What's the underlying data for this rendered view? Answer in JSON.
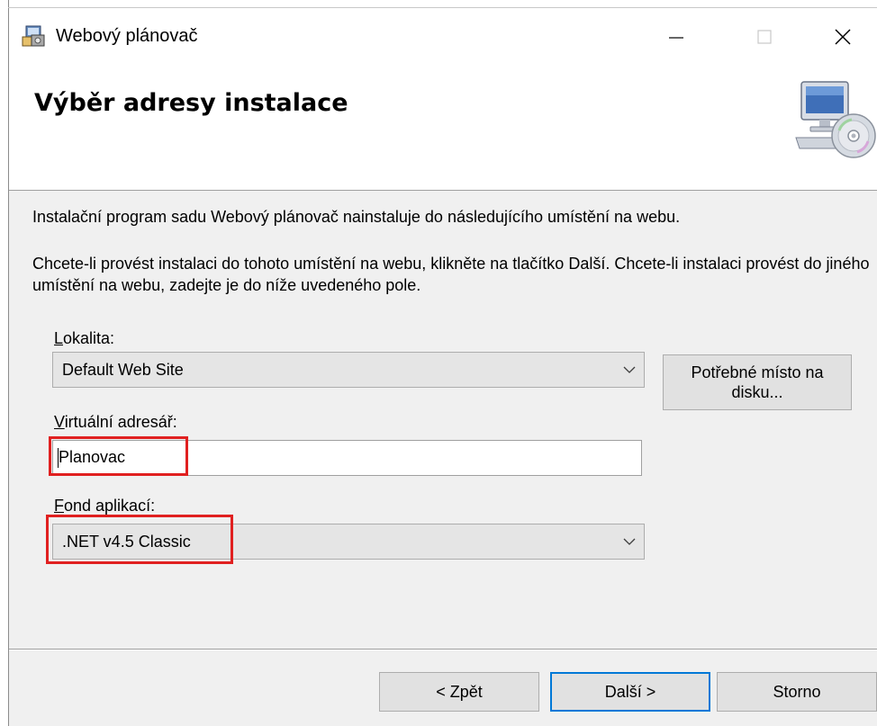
{
  "window": {
    "title": "Webový plánovač",
    "controls": {
      "minimize": "—",
      "close": "✕"
    }
  },
  "banner": {
    "title": "Výběr adresy instalace",
    "icon": "computer-cd-icon"
  },
  "body": {
    "intro": "Instalační program sadu Webový plánovač nainstaluje do následujícího umístění na webu.",
    "instructions": "Chcete-li provést instalaci do tohoto umístění na webu, klikněte na tlačítko Další. Chcete-li instalaci provést do jiného umístění na webu, zadejte je do níže uvedeného pole."
  },
  "fields": {
    "site": {
      "label_first": "L",
      "label_rest": "okalita:",
      "value": "Default Web Site"
    },
    "disk_button": {
      "line1": "Potřebné místo na",
      "line2": "disku..."
    },
    "virtual_dir": {
      "label_first": "V",
      "label_rest": "irtuální adresář:",
      "value": "Planovac"
    },
    "app_pool": {
      "label_first": "F",
      "label_rest": "ond aplikací:",
      "value": ".NET v4.5 Classic"
    }
  },
  "buttons": {
    "back": "< Zpět",
    "next": "Další >",
    "cancel": "Storno"
  },
  "colors": {
    "highlight": "#e02020",
    "default_button_border": "#0078d7"
  }
}
